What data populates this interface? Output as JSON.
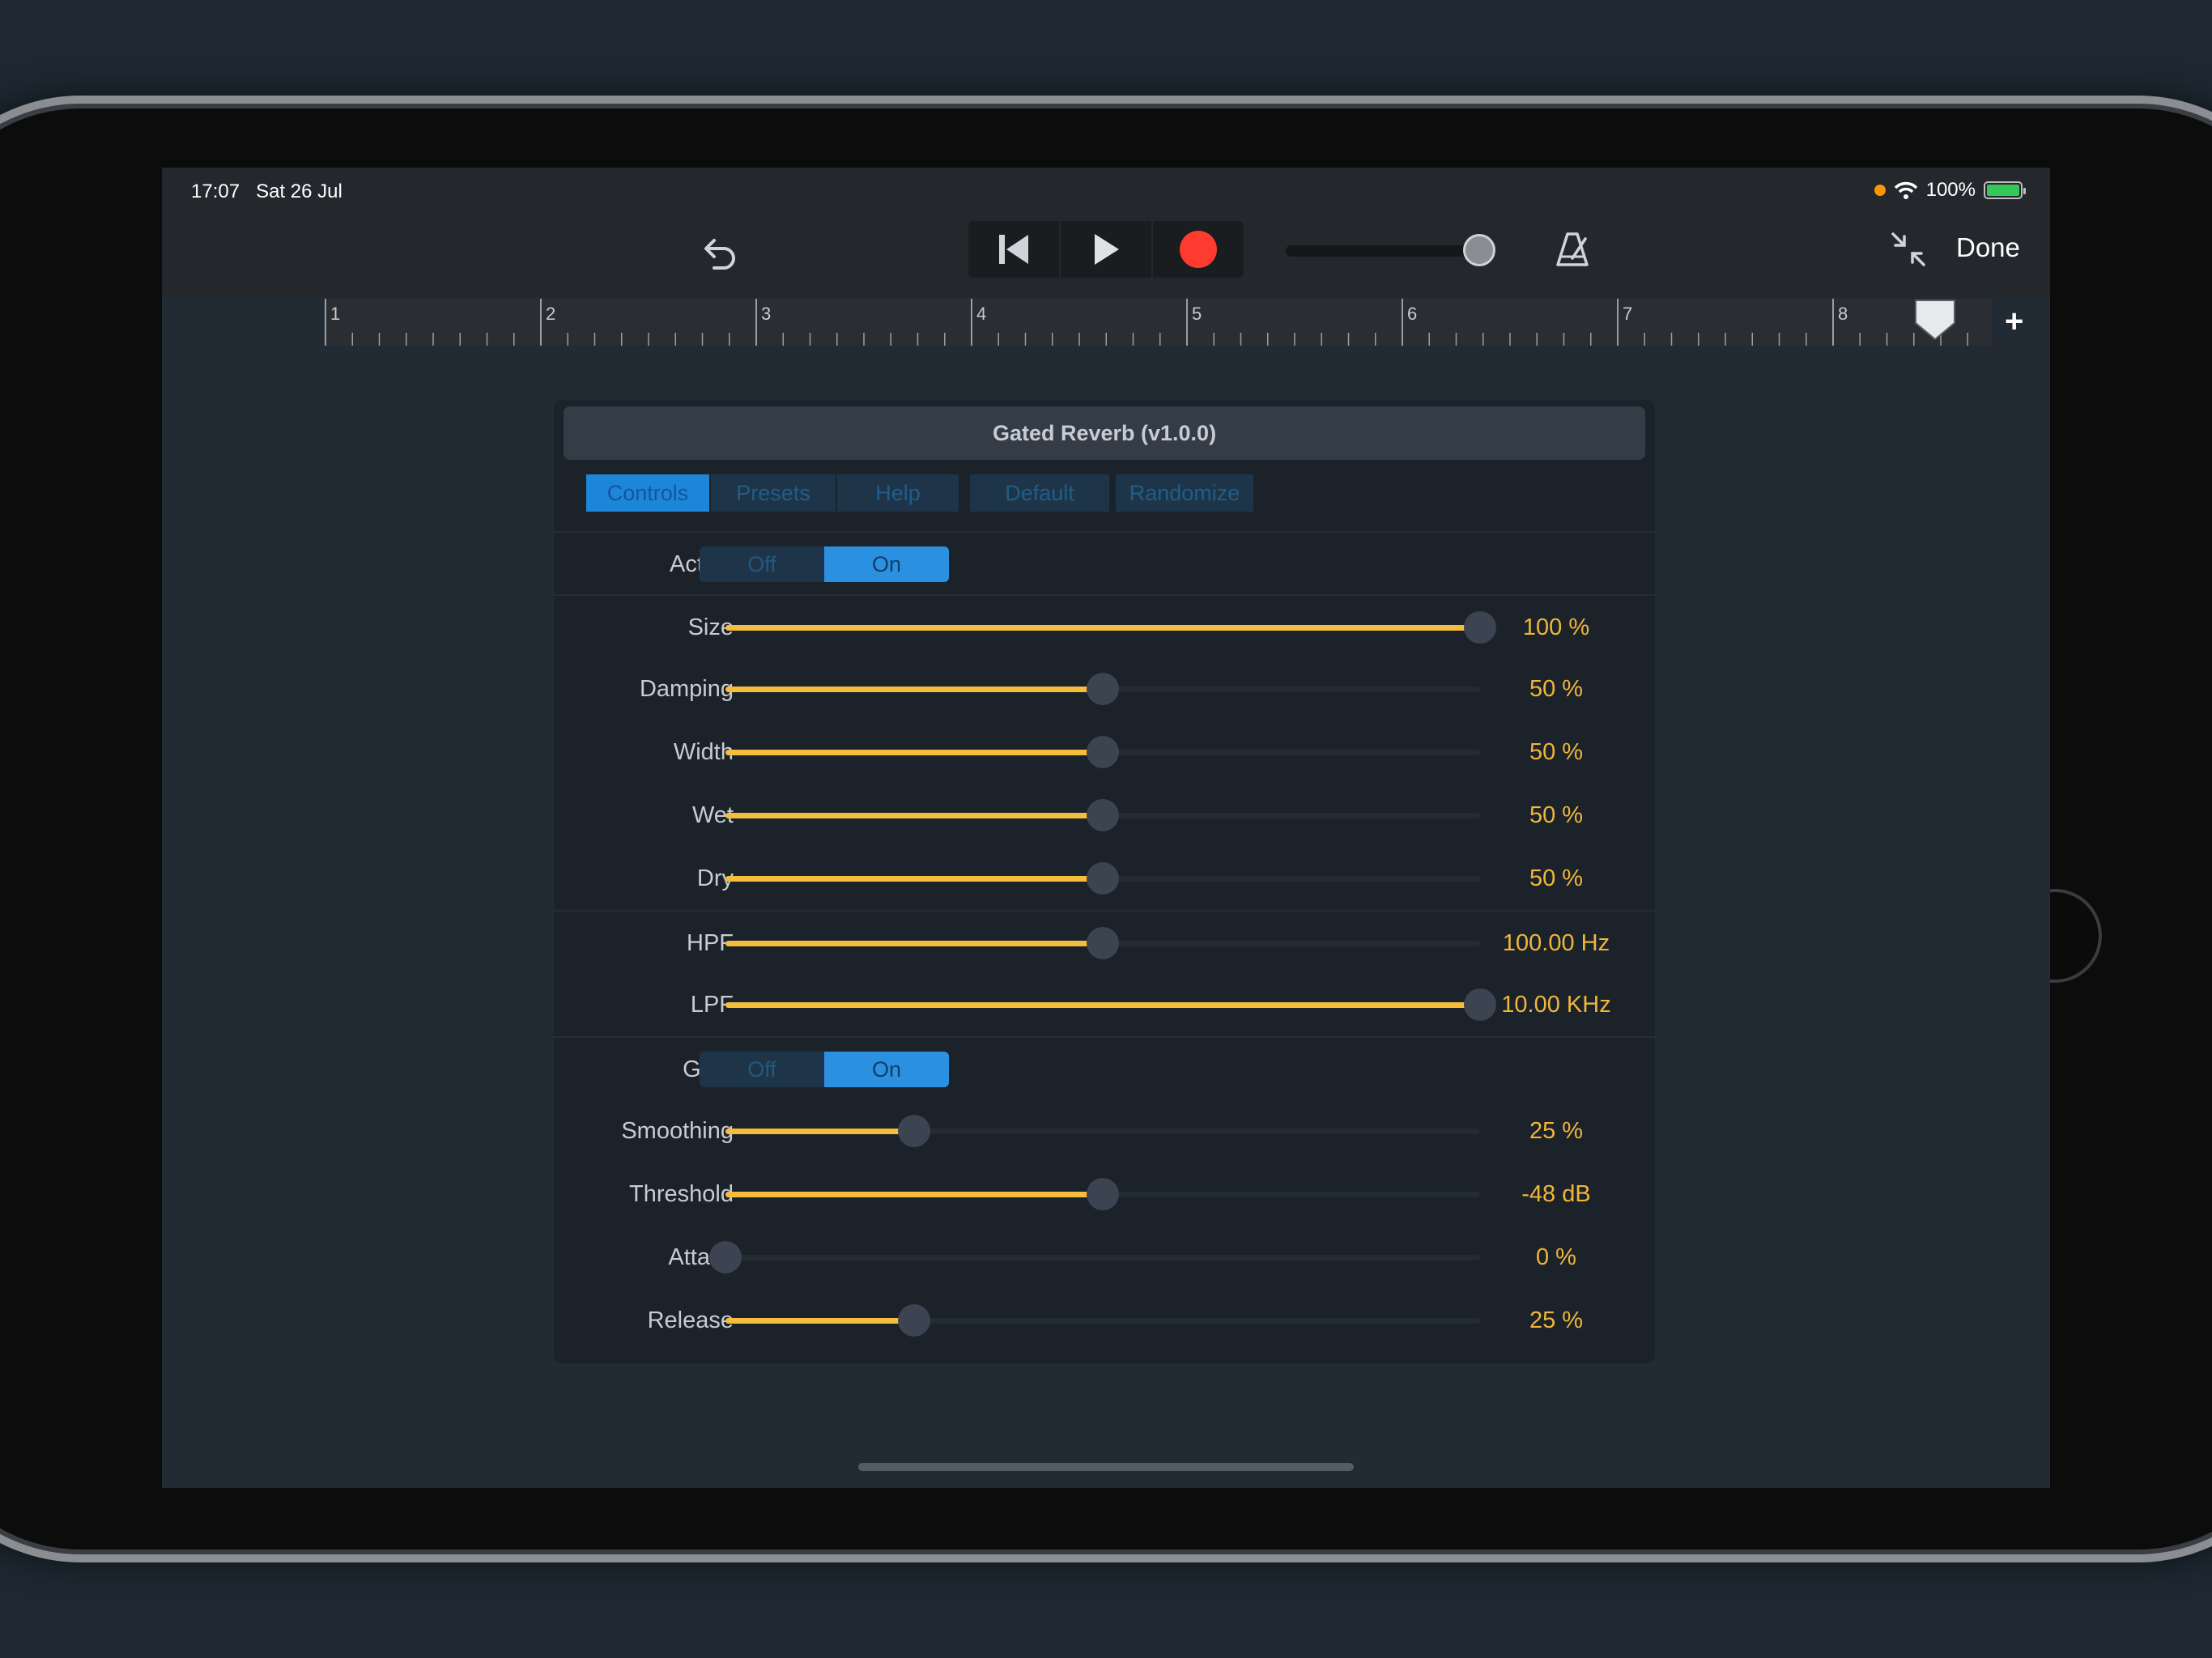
{
  "status_bar": {
    "time": "17:07",
    "date": "Sat 26 Jul",
    "battery": "100%"
  },
  "toolbar": {
    "done_label": "Done",
    "volume_fraction": 0.92
  },
  "icons": {
    "undo": "undo-icon",
    "rewind": "skip-back-icon",
    "play": "play-icon",
    "record": "record-icon",
    "metronome": "metronome-icon",
    "collapse": "collapse-icon",
    "add": "plus-icon"
  },
  "ruler": {
    "bars": [
      "1",
      "2",
      "3",
      "4",
      "5",
      "6",
      "7",
      "8"
    ]
  },
  "plugin": {
    "title": "Gated Reverb (v1.0.0)",
    "tabs": {
      "controls": "Controls",
      "presets": "Presets",
      "help": "Help",
      "default": "Default",
      "randomize": "Randomize"
    },
    "active": {
      "label": "Active",
      "off": "Off",
      "on": "On",
      "state": "On"
    },
    "gate": {
      "label": "Gate",
      "off": "Off",
      "on": "On",
      "state": "On"
    },
    "params": {
      "size": {
        "label": "Size",
        "value": "100 %",
        "level": 1.0
      },
      "damping": {
        "label": "Damping",
        "value": "50 %",
        "level": 0.5
      },
      "width": {
        "label": "Width",
        "value": "50 %",
        "level": 0.5
      },
      "wet": {
        "label": "Wet",
        "value": "50 %",
        "level": 0.5
      },
      "dry": {
        "label": "Dry",
        "value": "50 %",
        "level": 0.5
      },
      "hpf": {
        "label": "HPF",
        "value": "100.00 Hz",
        "level": 0.5
      },
      "lpf": {
        "label": "LPF",
        "value": "10.00 KHz",
        "level": 1.0
      },
      "smoothing": {
        "label": "Smoothing",
        "value": "25 %",
        "level": 0.25
      },
      "threshold": {
        "label": "Threshold",
        "value": "-48 dB",
        "level": 0.5
      },
      "attack": {
        "label": "Attack",
        "value": "0 %",
        "level": 0.0
      },
      "release": {
        "label": "Release",
        "value": "25 %",
        "level": 0.25
      }
    }
  },
  "colors": {
    "accent_blue": "#2b90e0",
    "slider_fill": "#f5bd3c",
    "value_text": "#f0b63a",
    "record_red": "#ff3b30"
  }
}
